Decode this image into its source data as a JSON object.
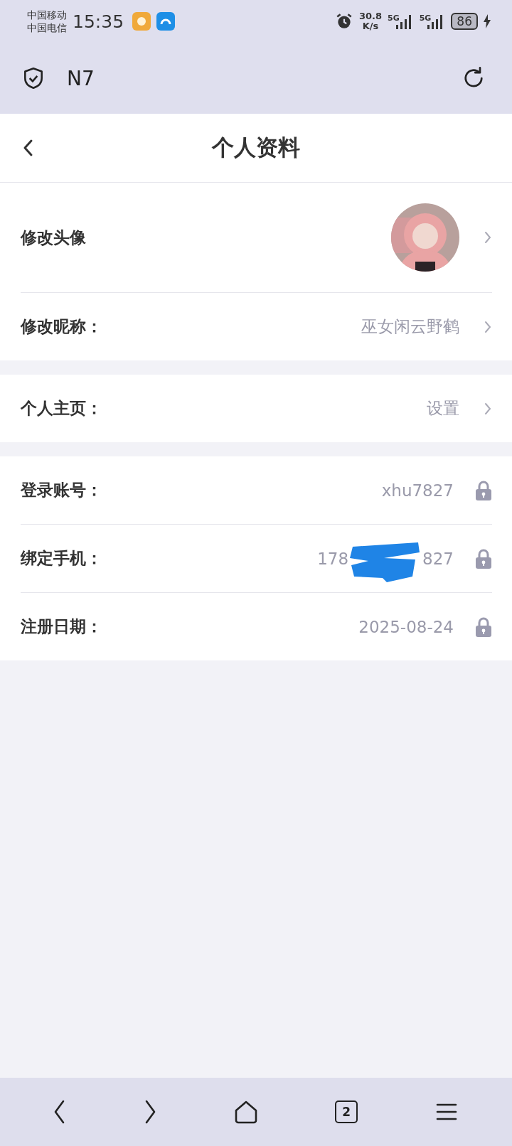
{
  "status_bar": {
    "carriers": [
      "中国移动",
      "中国电信"
    ],
    "time": "15:35",
    "net_speed": [
      "30.8",
      "K/s"
    ],
    "signals": [
      "5G",
      "5G"
    ],
    "battery": "86"
  },
  "browser_bar": {
    "tab_title": "N7"
  },
  "header": {
    "title": "个人资料"
  },
  "sections": [
    {
      "rows": [
        {
          "kind": "avatar",
          "label": "修改头像"
        },
        {
          "kind": "link",
          "label": "修改昵称：",
          "value": "巫女闲云野鹤"
        }
      ]
    },
    {
      "rows": [
        {
          "kind": "link",
          "label": "个人主页：",
          "value": "设置"
        }
      ]
    },
    {
      "rows": [
        {
          "kind": "locked",
          "label": "登录账号：",
          "value": "xhu7827"
        },
        {
          "kind": "redacted",
          "label": "绑定手机：",
          "value_start": "178",
          "value_end": "827"
        },
        {
          "kind": "locked",
          "label": "注册日期：",
          "value": "2025-08-24"
        }
      ]
    }
  ],
  "nav_bar": {
    "tab_count": "2"
  }
}
